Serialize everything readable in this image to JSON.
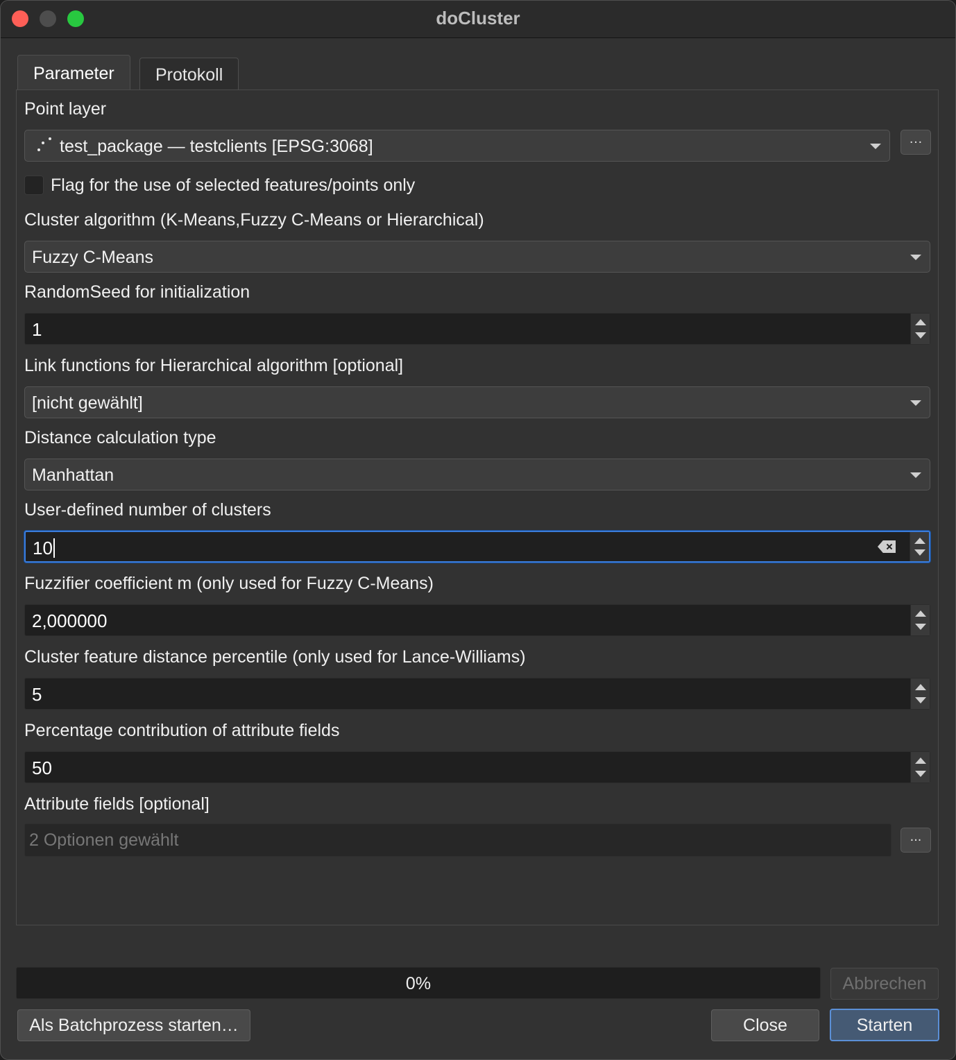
{
  "window": {
    "title": "doCluster"
  },
  "tabs": [
    {
      "label": "Parameter"
    },
    {
      "label": "Protokoll"
    }
  ],
  "params": {
    "point_layer": {
      "label": "Point layer",
      "value": "test_package — testclients [EPSG:3068]",
      "icon": "point-layer-icon"
    },
    "selected_only": {
      "label": "Flag for the use of selected features/points only",
      "checked": false
    },
    "cluster_algorithm": {
      "label": "Cluster algorithm (K-Means,Fuzzy C-Means or Hierarchical)",
      "value": "Fuzzy C-Means"
    },
    "random_seed": {
      "label": "RandomSeed for initialization",
      "value": "1"
    },
    "link_functions": {
      "label": "Link functions for Hierarchical algorithm [optional]",
      "value": "[nicht gewählt]"
    },
    "distance_type": {
      "label": "Distance calculation type",
      "value": "Manhattan"
    },
    "num_clusters": {
      "label": "User-defined number of clusters",
      "value": "10"
    },
    "fuzzifier": {
      "label": "Fuzzifier coefficient m (only used for Fuzzy C-Means)",
      "value": "2,000000"
    },
    "distance_percentile": {
      "label": "Cluster feature distance percentile (only used for Lance-Williams)",
      "value": "5"
    },
    "attribute_percentage": {
      "label": "Percentage contribution of attribute fields",
      "value": "50"
    },
    "attribute_fields": {
      "label": "Attribute fields [optional]",
      "value": "2 Optionen gewählt"
    }
  },
  "buttons": {
    "ellipsis": "…",
    "ellipsis_plain": "...",
    "cancel": "Abbrechen",
    "batch": "Als Batchprozess starten…",
    "close": "Close",
    "start": "Starten"
  },
  "progress": {
    "value": 0,
    "label": "0%"
  },
  "colors": {
    "accent": "#3b7cd9",
    "close": "#fe5f57",
    "maximize": "#28c840",
    "background": "#323232"
  }
}
